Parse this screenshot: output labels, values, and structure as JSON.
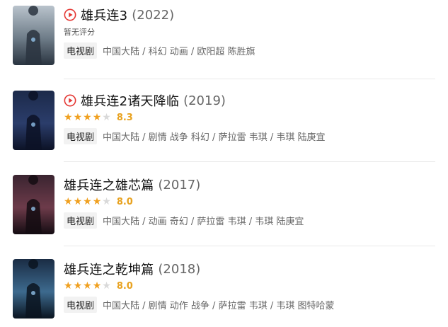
{
  "results": [
    {
      "title": "雄兵连3",
      "year": "(2022)",
      "playable": true,
      "rating_text": "暂无评分",
      "score": "",
      "stars": 0,
      "badge": "电视剧",
      "tags": "中国大陆 / 科幻 动画 / 欧阳超 陈胜旗",
      "poster_palette": [
        "#b9c3cc",
        "#6e7c88",
        "#2a3440"
      ]
    },
    {
      "title": "雄兵连2诸天降临",
      "year": "(2019)",
      "playable": true,
      "rating_text": "",
      "score": "8.3",
      "stars": 4,
      "badge": "电视剧",
      "tags": "中国大陆 / 剧情 战争 科幻 / 萨拉雷 韦琪 / 韦琪 陆庚宜",
      "poster_palette": [
        "#1c2a4a",
        "#2b3d6b",
        "#0c1226"
      ]
    },
    {
      "title": "雄兵连之雄芯篇",
      "year": "(2017)",
      "playable": false,
      "rating_text": "",
      "score": "8.0",
      "stars": 4,
      "badge": "电视剧",
      "tags": "中国大陆 / 动画 奇幻 / 萨拉雷 韦琪 / 韦琪 陆庚宜",
      "poster_palette": [
        "#3a2430",
        "#6d3b4a",
        "#140c12"
      ]
    },
    {
      "title": "雄兵连之乾坤篇",
      "year": "(2018)",
      "playable": false,
      "rating_text": "",
      "score": "8.0",
      "stars": 4,
      "badge": "电视剧",
      "tags": "中国大陆 / 剧情 动作 战争 / 萨拉雷 韦琪 / 韦琪 图特哈蒙",
      "poster_palette": [
        "#1a2c44",
        "#3d6a8e",
        "#0a1420"
      ]
    }
  ],
  "colors": {
    "play_accent": "#e53935",
    "star": "#f0a01f",
    "score": "#e8a21f"
  },
  "icons": {
    "play": "play-circle-icon",
    "star": "star-icon"
  }
}
